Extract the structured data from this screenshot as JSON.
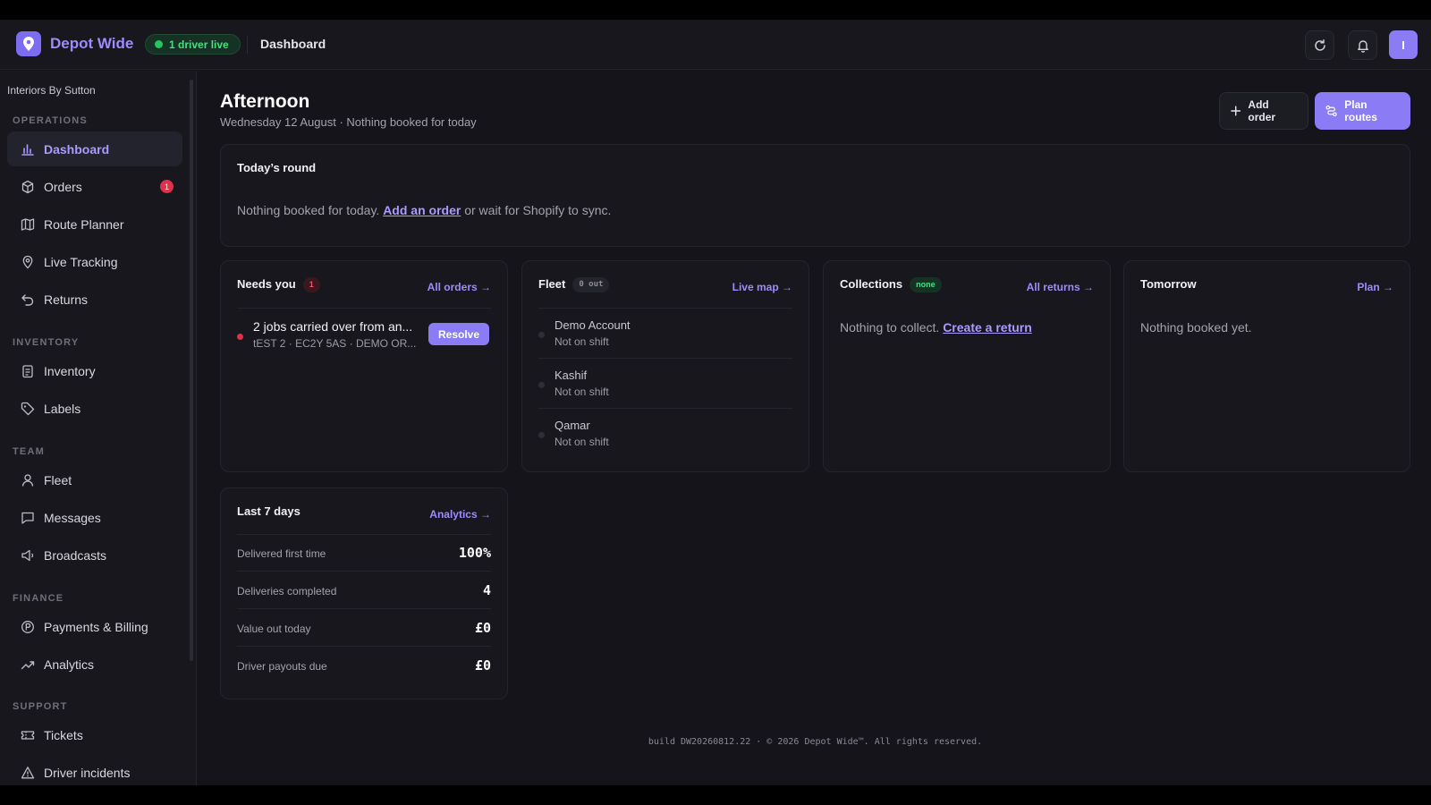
{
  "topbar": {
    "brand": "Depot Wide",
    "live_pill": "1 driver live",
    "breadcrumb": "Dashboard",
    "avatar_initial": "I",
    "icons": [
      "refresh-icon",
      "bell-icon"
    ]
  },
  "sidebar": {
    "org_name": "Interiors By Sutton",
    "sections": {
      "operations": "OPERATIONS",
      "inventory": "INVENTORY",
      "team": "TEAM",
      "finance": "FINANCE",
      "support": "SUPPORT"
    },
    "items": [
      {
        "label": "Dashboard",
        "icon": "bar-chart-icon",
        "active": true
      },
      {
        "label": "Orders",
        "icon": "box-icon",
        "badge": "1"
      },
      {
        "label": "Route Planner",
        "icon": "map-icon"
      },
      {
        "label": "Live Tracking",
        "icon": "pin-icon"
      },
      {
        "label": "Returns",
        "icon": "return-arrow-icon"
      },
      {
        "label": "Inventory",
        "icon": "clipboard-icon"
      },
      {
        "label": "Labels",
        "icon": "tag-icon"
      },
      {
        "label": "Fleet",
        "icon": "person-icon"
      },
      {
        "label": "Messages",
        "icon": "chat-icon"
      },
      {
        "label": "Broadcasts",
        "icon": "megaphone-icon"
      },
      {
        "label": "Payments & Billing",
        "icon": "coin-icon"
      },
      {
        "label": "Analytics",
        "icon": "trend-icon"
      },
      {
        "label": "Tickets",
        "icon": "ticket-icon"
      },
      {
        "label": "Driver incidents",
        "icon": "warning-icon"
      }
    ]
  },
  "header": {
    "greeting": "Afternoon",
    "subline": "Wednesday 12 August · Nothing booked for today",
    "add_order": "Add order",
    "plan_routes": "Plan routes"
  },
  "todays_round": {
    "title": "Today’s round",
    "text_before": "Nothing booked for today.",
    "link": "Add an order",
    "text_after": "or wait for Shopify to sync."
  },
  "needs_you": {
    "title": "Needs you",
    "count": "1",
    "link": "All orders →",
    "item_title": "2 jobs carried over from an...",
    "item_sub": "tEST 2 · EC2Y 5AS · DEMO OR...",
    "resolve": "Resolve"
  },
  "fleet": {
    "title": "Fleet",
    "pill": "0 out",
    "link": "Live map →",
    "drivers": [
      {
        "name": "Demo Account",
        "status": "Not on shift"
      },
      {
        "name": "Kashif",
        "status": "Not on shift"
      },
      {
        "name": "Qamar",
        "status": "Not on shift"
      }
    ]
  },
  "collections": {
    "title": "Collections",
    "pill": "none",
    "link": "All returns →",
    "text_before": "Nothing to collect.",
    "text_link": "Create a return"
  },
  "tomorrow": {
    "title": "Tomorrow",
    "link": "Plan →",
    "text": "Nothing booked yet."
  },
  "last7": {
    "title": "Last 7 days",
    "link": "Analytics →",
    "stats": [
      {
        "label": "Delivered first time",
        "value": "100%"
      },
      {
        "label": "Deliveries completed",
        "value": "4"
      },
      {
        "label": "Value out today",
        "value": "£0"
      },
      {
        "label": "Driver payouts due",
        "value": "£0"
      }
    ]
  },
  "footer": "build DW20260812.22 · © 2026 Depot Wide™. All rights reserved.",
  "colors": {
    "accent": "#8b7bf5",
    "live_green": "#22c55e",
    "badge_red": "#e0304a",
    "background": "#14141a"
  }
}
